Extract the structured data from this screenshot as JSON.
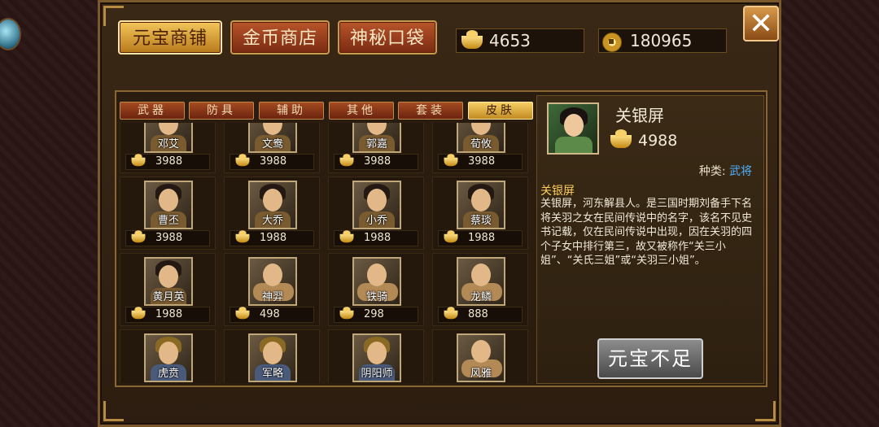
{
  "top_tabs": [
    {
      "label": "元宝商铺",
      "active": true
    },
    {
      "label": "金币商店",
      "active": false
    },
    {
      "label": "神秘口袋",
      "active": false
    }
  ],
  "currency": {
    "ingot": {
      "icon": "gold-ingot-icon",
      "value": "4653"
    },
    "coin": {
      "icon": "gold-coin-icon",
      "value": "180965"
    }
  },
  "close_label": "✕",
  "categories": [
    {
      "label": "武器",
      "active": false
    },
    {
      "label": "防具",
      "active": false
    },
    {
      "label": "辅助",
      "active": false
    },
    {
      "label": "其他",
      "active": false
    },
    {
      "label": "套装",
      "active": false
    },
    {
      "label": "皮肤",
      "active": true
    }
  ],
  "items": [
    {
      "name": "邓艾",
      "price": "3988",
      "kind": "portrait"
    },
    {
      "name": "文鸯",
      "price": "3988",
      "kind": "portrait"
    },
    {
      "name": "郭嘉",
      "price": "3988",
      "kind": "portrait"
    },
    {
      "name": "荀攸",
      "price": "3988",
      "kind": "portrait"
    },
    {
      "name": "曹丕",
      "price": "3988",
      "kind": "portrait"
    },
    {
      "name": "大乔",
      "price": "1988",
      "kind": "portrait"
    },
    {
      "name": "小乔",
      "price": "1988",
      "kind": "portrait"
    },
    {
      "name": "蔡琰",
      "price": "1988",
      "kind": "portrait"
    },
    {
      "name": "黄月英",
      "price": "1988",
      "kind": "portrait"
    },
    {
      "name": "神羿",
      "price": "498",
      "kind": "mounted"
    },
    {
      "name": "铁骑",
      "price": "298",
      "kind": "mounted"
    },
    {
      "name": "龙鳞",
      "price": "888",
      "kind": "mounted"
    },
    {
      "name": "虎贲",
      "price": "",
      "kind": "soldier"
    },
    {
      "name": "军略",
      "price": "",
      "kind": "soldier"
    },
    {
      "name": "阴阳师",
      "price": "",
      "kind": "soldier"
    },
    {
      "name": "风雅",
      "price": "",
      "kind": "mounted"
    }
  ],
  "detail": {
    "name": "关银屏",
    "price": "4988",
    "type_label": "种类:",
    "type_value": "武将",
    "desc_title": "关银屏",
    "desc": "关银屏，河东解县人。是三国时期刘备手下名将关羽之女在民间传说中的名字，该名不见史书记载，仅在民间传说中出现，因在关羽的四个子女中排行第三，故又被称作“关三小姐”、“关氏三姐”或“关羽三小姐”。",
    "buy_label": "元宝不足"
  }
}
